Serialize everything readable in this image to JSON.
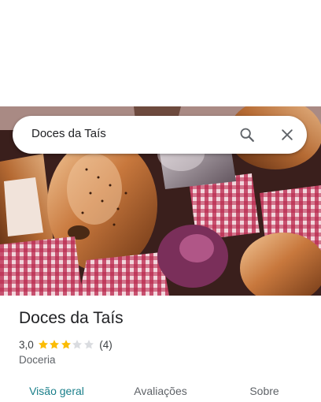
{
  "search": {
    "query": "Doces da Taís",
    "search_icon": "search-icon",
    "close_icon": "close-icon"
  },
  "photo": {
    "subject": "chocolates-candies-photo"
  },
  "place": {
    "name": "Doces da Taís",
    "rating": "3,0",
    "rating_value": 3,
    "rating_max": 5,
    "review_count": "(4)",
    "category": "Doceria"
  },
  "tabs": [
    {
      "label": "Visão geral",
      "active": true
    },
    {
      "label": "Avaliações",
      "active": false
    },
    {
      "label": "Sobre",
      "active": false
    }
  ],
  "colors": {
    "accent": "#1a7f8a",
    "star_filled": "#fbbc04",
    "star_empty": "#dadce0"
  }
}
